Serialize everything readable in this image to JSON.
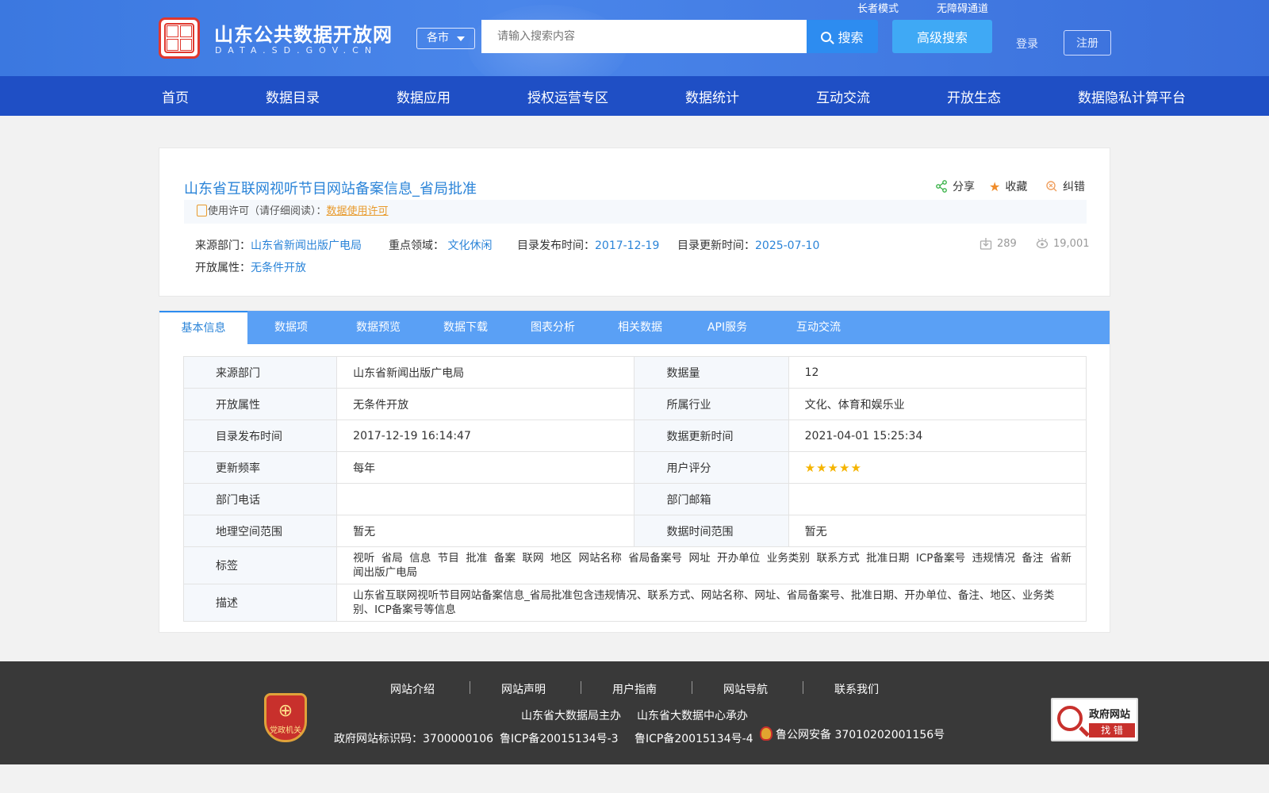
{
  "header": {
    "logo_title": "山东公共数据开放网",
    "logo_sub": "DATA.SD.GOV.CN",
    "city_select": "各市",
    "search_placeholder": "请输入搜索内容",
    "search_button": "搜索",
    "advanced_search": "高级搜索",
    "elder_mode": "长者模式",
    "accessibility": "无障碍通道",
    "login": "登录",
    "register": "注册"
  },
  "nav": [
    "首页",
    "数据目录",
    "数据应用",
    "授权运营专区",
    "数据统计",
    "互动交流",
    "开放生态",
    "数据隐私计算平台"
  ],
  "dataset": {
    "title": "山东省互联网视听节目网站备案信息_省局批准",
    "actions": {
      "share": "分享",
      "favorite": "收藏",
      "report": "纠错"
    },
    "license_prefix": "使用许可（请仔细阅读）：",
    "license_link": "数据使用许可",
    "source_label": "来源部门：",
    "source_value": "山东省新闻出版广电局",
    "domain_label": "重点领域：",
    "domain_value": "文化休闲",
    "publish_label": "目录发布时间：",
    "publish_value": "2017-12-19",
    "update_label": "目录更新时间：",
    "update_value": "2025-07-10",
    "open_label": "开放属性：",
    "open_value": "无条件开放",
    "downloads": "289",
    "views": "19,001"
  },
  "tabs": [
    "基本信息",
    "数据项",
    "数据预览",
    "数据下载",
    "图表分析",
    "相关数据",
    "API服务",
    "互动交流"
  ],
  "basic_info": {
    "source_dept_k": "来源部门",
    "source_dept_v": "山东省新闻出版广电局",
    "data_amount_k": "数据量",
    "data_amount_v": "12",
    "open_attr_k": "开放属性",
    "open_attr_v": "无条件开放",
    "industry_k": "所属行业",
    "industry_v": "文化、体育和娱乐业",
    "publish_time_k": "目录发布时间",
    "publish_time_v": "2017-12-19 16:14:47",
    "update_time_k": "数据更新时间",
    "update_time_v": "2021-04-01 15:25:34",
    "frequency_k": "更新频率",
    "frequency_v": "每年",
    "rating_k": "用户评分",
    "rating_stars": 5,
    "phone_k": "部门电话",
    "phone_v": "",
    "email_k": "部门邮箱",
    "email_v": "",
    "geo_k": "地理空间范围",
    "geo_v": "暂无",
    "time_range_k": "数据时间范围",
    "time_range_v": "暂无",
    "tags_k": "标签",
    "tags_v": "视听 省局 信息 节目 批准 备案 联网 地区 网站名称 省局备案号 网址 开办单位 业务类别 联系方式 批准日期 ICP备案号 违规情况 备注 省新闻出版广电局",
    "desc_k": "描述",
    "desc_v": "山东省互联网视听节目网站备案信息_省局批准包含违规情况、联系方式、网站名称、网址、省局备案号、批准日期、开办单位、备注、地区、业务类别、ICP备案号等信息"
  },
  "footer": {
    "links": [
      "网站介绍",
      "网站声明",
      "用户指南",
      "网站导航",
      "联系我们"
    ],
    "host": "山东省大数据局主办",
    "operator": "山东省大数据中心承办",
    "site_id": "政府网站标识码：3700000106",
    "icp1": "鲁ICP备20015134号-3",
    "icp2": "鲁ICP备20015134号-4",
    "police": "鲁公网安备 37010202001156号",
    "badge": "党政机关",
    "gov_err_1": "政府网站",
    "gov_err_2": "找 错"
  },
  "colors": {
    "nav_bg": "#1f4fc5",
    "tab_bg": "#5aa0f5",
    "link": "#2b84d8",
    "license": "#e89a2c",
    "footer_bg": "#393939"
  }
}
